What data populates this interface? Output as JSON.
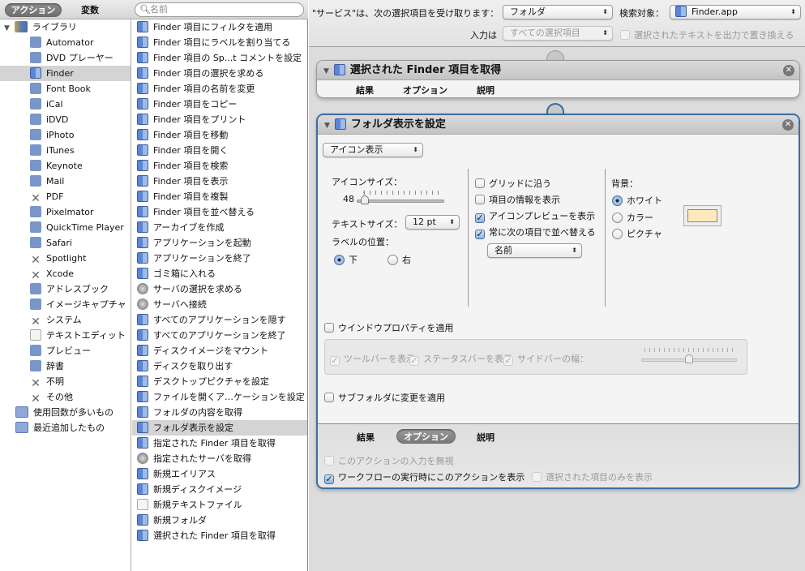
{
  "toolbar": {
    "actions_tab": "アクション",
    "variables_tab": "変数",
    "search_placeholder": "名前"
  },
  "library": {
    "root": "ライブラリ",
    "items": [
      {
        "label": "Automator",
        "icon": "automator-icon",
        "kind": "app"
      },
      {
        "label": "DVD プレーヤー",
        "icon": "dvd-player-icon",
        "kind": "app"
      },
      {
        "label": "Finder",
        "icon": "finder-icon",
        "kind": "finder",
        "selected": true
      },
      {
        "label": "Font Book",
        "icon": "font-book-icon",
        "kind": "app"
      },
      {
        "label": "iCal",
        "icon": "ical-icon",
        "kind": "app"
      },
      {
        "label": "iDVD",
        "icon": "idvd-icon",
        "kind": "app"
      },
      {
        "label": "iPhoto",
        "icon": "iphoto-icon",
        "kind": "app"
      },
      {
        "label": "iTunes",
        "icon": "itunes-icon",
        "kind": "app"
      },
      {
        "label": "Keynote",
        "icon": "keynote-icon",
        "kind": "app"
      },
      {
        "label": "Mail",
        "icon": "mail-icon",
        "kind": "app"
      },
      {
        "label": "PDF",
        "icon": "tools-icon",
        "kind": "x"
      },
      {
        "label": "Pixelmator",
        "icon": "pixelmator-icon",
        "kind": "app"
      },
      {
        "label": "QuickTime Player",
        "icon": "quicktime-icon",
        "kind": "app"
      },
      {
        "label": "Safari",
        "icon": "safari-icon",
        "kind": "app"
      },
      {
        "label": "Spotlight",
        "icon": "tools-icon",
        "kind": "x"
      },
      {
        "label": "Xcode",
        "icon": "tools-icon",
        "kind": "x"
      },
      {
        "label": "アドレスブック",
        "icon": "address-book-icon",
        "kind": "app"
      },
      {
        "label": "イメージキャプチャ",
        "icon": "image-capture-icon",
        "kind": "app"
      },
      {
        "label": "システム",
        "icon": "tools-icon",
        "kind": "x"
      },
      {
        "label": "テキストエディット",
        "icon": "textedit-icon",
        "kind": "doc"
      },
      {
        "label": "プレビュー",
        "icon": "preview-icon",
        "kind": "app"
      },
      {
        "label": "辞書",
        "icon": "dictionary-icon",
        "kind": "app"
      },
      {
        "label": "不明",
        "icon": "tools-icon",
        "kind": "x"
      },
      {
        "label": "その他",
        "icon": "tools-icon",
        "kind": "x"
      }
    ],
    "smart_groups": [
      "使用回数が多いもの",
      "最近追加したもの"
    ]
  },
  "actions": [
    {
      "label": "Finder 項目にフィルタを適用",
      "kind": "finder"
    },
    {
      "label": "Finder 項目にラベルを割り当てる",
      "kind": "finder"
    },
    {
      "label": "Finder 項目の Sp...t コメントを設定",
      "kind": "finder"
    },
    {
      "label": "Finder 項目の選択を求める",
      "kind": "finder"
    },
    {
      "label": "Finder 項目の名前を変更",
      "kind": "finder"
    },
    {
      "label": "Finder 項目をコピー",
      "kind": "finder"
    },
    {
      "label": "Finder 項目をプリント",
      "kind": "finder"
    },
    {
      "label": "Finder 項目を移動",
      "kind": "finder"
    },
    {
      "label": "Finder 項目を開く",
      "kind": "finder"
    },
    {
      "label": "Finder 項目を検索",
      "kind": "finder"
    },
    {
      "label": "Finder 項目を表示",
      "kind": "finder"
    },
    {
      "label": "Finder 項目を複製",
      "kind": "finder"
    },
    {
      "label": "Finder 項目を並べ替える",
      "kind": "finder"
    },
    {
      "label": "アーカイブを作成",
      "kind": "finder"
    },
    {
      "label": "アプリケーションを起動",
      "kind": "finder"
    },
    {
      "label": "アプリケーションを終了",
      "kind": "finder"
    },
    {
      "label": "ゴミ箱に入れる",
      "kind": "finder"
    },
    {
      "label": "サーバの選択を求める",
      "kind": "server"
    },
    {
      "label": "サーバへ接続",
      "kind": "server"
    },
    {
      "label": "すべてのアプリケーションを隠す",
      "kind": "finder"
    },
    {
      "label": "すべてのアプリケーションを終了",
      "kind": "finder"
    },
    {
      "label": "ディスクイメージをマウント",
      "kind": "finder"
    },
    {
      "label": "ディスクを取り出す",
      "kind": "finder"
    },
    {
      "label": "デスクトップピクチャを設定",
      "kind": "finder"
    },
    {
      "label": "ファイルを開くア…ケーションを設定",
      "kind": "finder"
    },
    {
      "label": "フォルダの内容を取得",
      "kind": "finder"
    },
    {
      "label": "フォルダ表示を設定",
      "kind": "finder",
      "selected": true
    },
    {
      "label": "指定された Finder 項目を取得",
      "kind": "finder"
    },
    {
      "label": "指定されたサーバを取得",
      "kind": "server"
    },
    {
      "label": "新規エイリアス",
      "kind": "finder"
    },
    {
      "label": "新規ディスクイメージ",
      "kind": "finder"
    },
    {
      "label": "新規テキストファイル",
      "kind": "doc"
    },
    {
      "label": "新規フォルダ",
      "kind": "finder"
    },
    {
      "label": "選択された Finder 項目を取得",
      "kind": "finder"
    }
  ],
  "service": {
    "receives_label": "\"サービス\"は、次の選択項目を受け取ります：",
    "receives_value": "フォルダ",
    "in_label": "検索対象：",
    "in_value": "Finder.app",
    "input_label": "入力は",
    "input_value": "すべての選択項目",
    "replace_label": "選択されたテキストを出力で置き換える"
  },
  "action1": {
    "title": "選択された Finder 項目を取得",
    "tabs": [
      "結果",
      "オプション",
      "説明"
    ]
  },
  "action2": {
    "title": "フォルダ表示を設定",
    "view_mode": "アイコン表示",
    "icon_size_label": "アイコンサイズ：",
    "icon_size_value": "48",
    "icon_size_fraction": 0.05,
    "text_size_label": "テキストサイズ：",
    "text_size_value": "12 pt",
    "label_pos_label": "ラベルの位置：",
    "label_bottom": "下",
    "label_right": "右",
    "grid": "グリッドに沿う",
    "item_info": "項目の情報を表示",
    "icon_preview": "アイコンプレビューを表示",
    "arrange_by": "常に次の項目で並べ替える",
    "arrange_value": "名前",
    "background_label": "背景：",
    "bg_white": "ホワイト",
    "bg_color": "カラー",
    "bg_picture": "ピクチャ",
    "bg_swatch_color": "#fde9bd",
    "window_props": "ウインドウプロパティを適用",
    "toolbar": "ツールバーを表示",
    "statusbar": "ステータスバーを表示",
    "sidebar_width": "サイドバーの幅：",
    "sidebar_fraction": 0.5,
    "subfolders": "サブフォルダに変更を適用",
    "tabs": [
      "結果",
      "オプション",
      "説明"
    ],
    "ignore_input": "このアクションの入力を無視",
    "show_when_run": "ワークフローの実行時にこのアクションを表示",
    "show_selected_only": "選択された項目のみを表示"
  }
}
